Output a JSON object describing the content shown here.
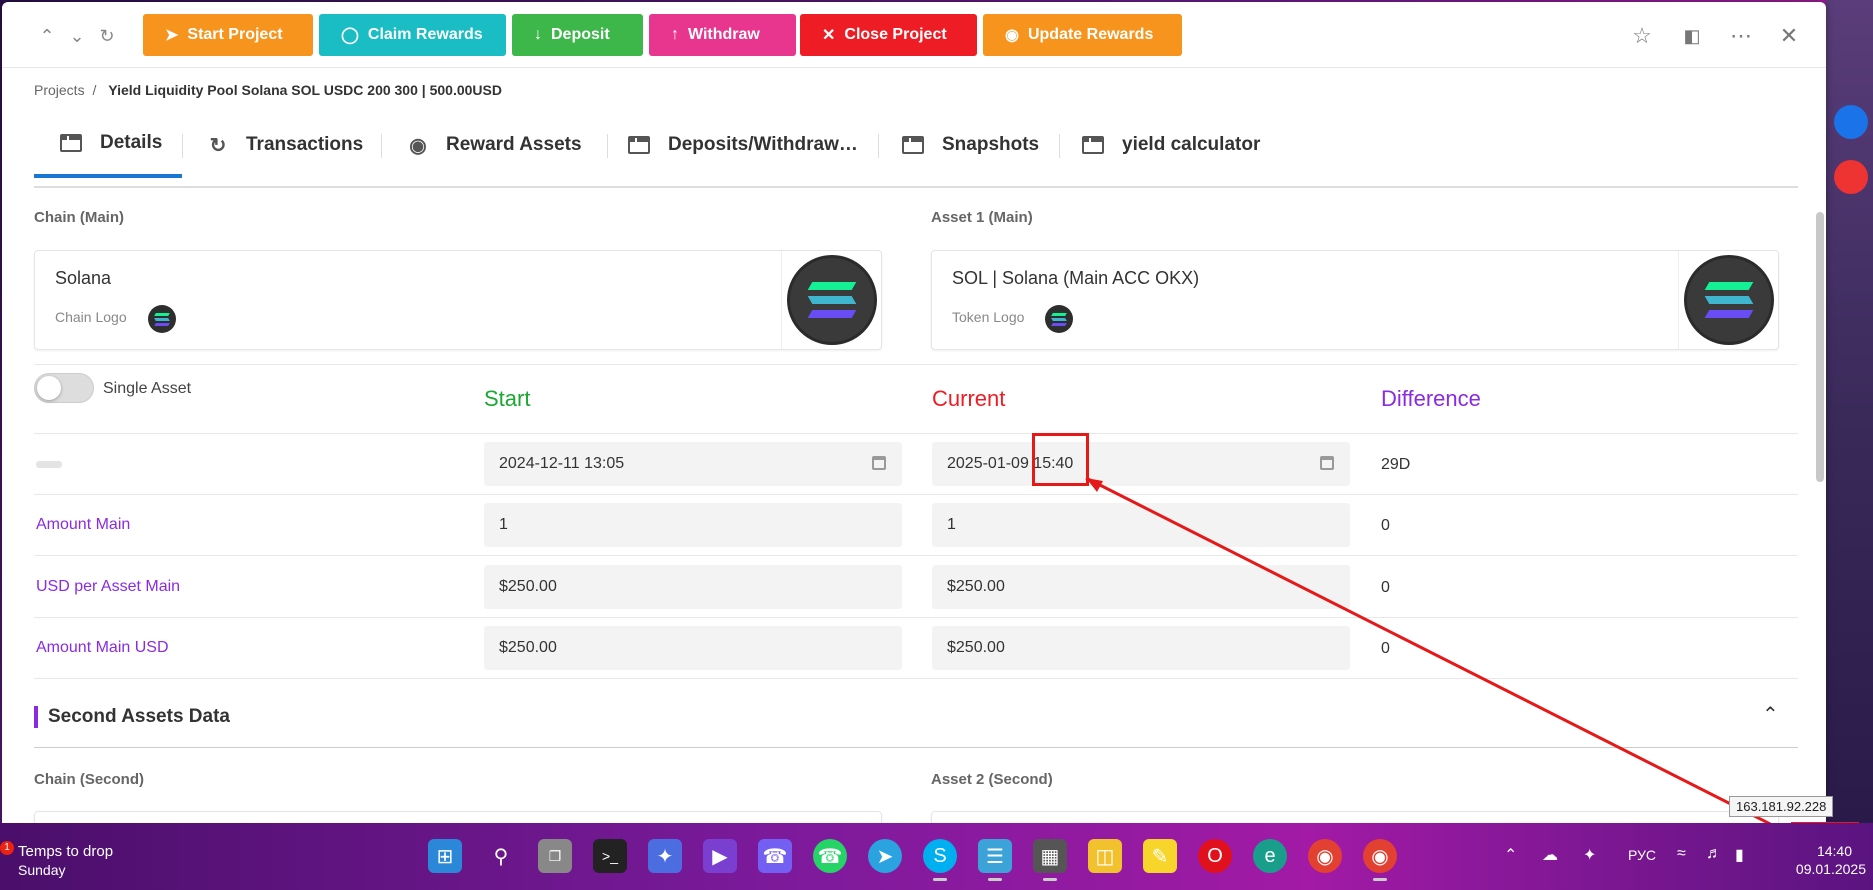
{
  "toolbar": {
    "buttons": {
      "start": "Start Project",
      "claim": "Claim Rewards",
      "deposit": "Deposit",
      "withdraw": "Withdraw",
      "close": "Close Project",
      "update": "Update Rewards"
    }
  },
  "breadcrumb": {
    "root": "Projects",
    "separator": "/",
    "current": "Yield Liquidity Pool Solana SOL USDC 200 300 | 500.00USD"
  },
  "tabs": [
    {
      "label": "Details",
      "icon": "window-icon"
    },
    {
      "label": "Transactions",
      "icon": "exchange-icon"
    },
    {
      "label": "Reward Assets",
      "icon": "medal-icon"
    },
    {
      "label": "Deposits/Withdraw…",
      "icon": "window-icon"
    },
    {
      "label": "Snapshots",
      "icon": "window-icon"
    },
    {
      "label": "yield calculator",
      "icon": "window-icon"
    }
  ],
  "main_section": {
    "chain_label": "Chain (Main)",
    "asset_label": "Asset 1 (Main)",
    "chain_card": {
      "name": "Solana",
      "sub": "Chain Logo"
    },
    "asset_card": {
      "name": "SOL | Solana (Main ACC OKX)",
      "sub": "Token Logo"
    }
  },
  "single_asset_label": "Single Asset",
  "columns": {
    "start": "Start",
    "current": "Current",
    "difference": "Difference"
  },
  "colors": {
    "start": "#1aa832",
    "current": "#ee1c25",
    "difference": "#8a2be2",
    "label": "#8a2be2"
  },
  "rows": {
    "date": {
      "start": "2024-12-11 13:05",
      "current": "2025-01-09 15:40",
      "difference": "29D"
    },
    "amount_main": {
      "label": "Amount Main",
      "start": "1",
      "current": "1",
      "difference": "0"
    },
    "usd_per_asset": {
      "label": "USD per Asset Main",
      "start": "$250.00",
      "current": "$250.00",
      "difference": "0"
    },
    "amount_main_usd": {
      "label": "Amount Main USD",
      "start": "$250.00",
      "current": "$250.00",
      "difference": "0"
    }
  },
  "second_section": {
    "title": "Second Assets Data",
    "chain_label": "Chain (Second)",
    "asset_label": "Asset 2 (Second)"
  },
  "tooltip_ip": "163.181.92.228",
  "taskbar": {
    "weather_title": "Temps to drop",
    "weather_sub": "Sunday",
    "notification_count": "1",
    "lang": "РУС",
    "time": "14:40",
    "date": "09.01.2025"
  }
}
